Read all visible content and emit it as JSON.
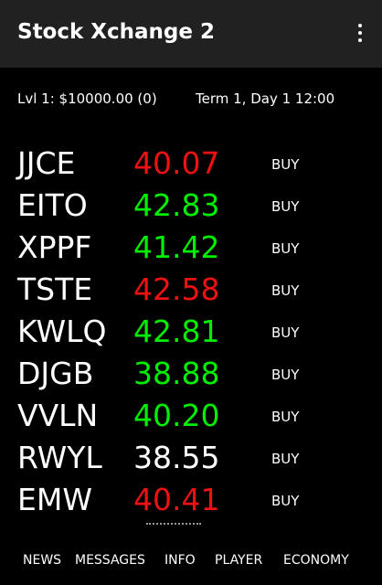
{
  "app": {
    "title": "Stock Xchange 2",
    "menu_icon": "more-vert-icon"
  },
  "status": {
    "level": "Lvl 1: $10000.00 (0)",
    "date_time": "Term 1, Day 1  12:00"
  },
  "colors": {
    "background": "#000000",
    "appbar": "#212121",
    "price_up": "#00ee00",
    "price_down": "#ee1111",
    "price_neutral": "#ffffff"
  },
  "stocks": [
    {
      "ticker": "JJCE",
      "price": "40.07",
      "trend": "down",
      "action": "BUY"
    },
    {
      "ticker": "EITO",
      "price": "42.83",
      "trend": "up",
      "action": "BUY"
    },
    {
      "ticker": "XPPF",
      "price": "41.42",
      "trend": "up",
      "action": "BUY"
    },
    {
      "ticker": "TSTE",
      "price": "42.58",
      "trend": "down",
      "action": "BUY"
    },
    {
      "ticker": "KWLQ",
      "price": "42.81",
      "trend": "up",
      "action": "BUY"
    },
    {
      "ticker": "DJGB",
      "price": "38.88",
      "trend": "up",
      "action": "BUY"
    },
    {
      "ticker": "VVLN",
      "price": "40.20",
      "trend": "up",
      "action": "BUY"
    },
    {
      "ticker": "RWYL",
      "price": "38.55",
      "trend": "neutral",
      "action": "BUY"
    },
    {
      "ticker": "EMW",
      "price": "40.41",
      "trend": "down",
      "action": "BUY"
    }
  ],
  "nav": {
    "items": [
      "NEWS",
      "MESSAGES",
      "INFO",
      "PLAYER",
      "ECONOMY"
    ]
  }
}
